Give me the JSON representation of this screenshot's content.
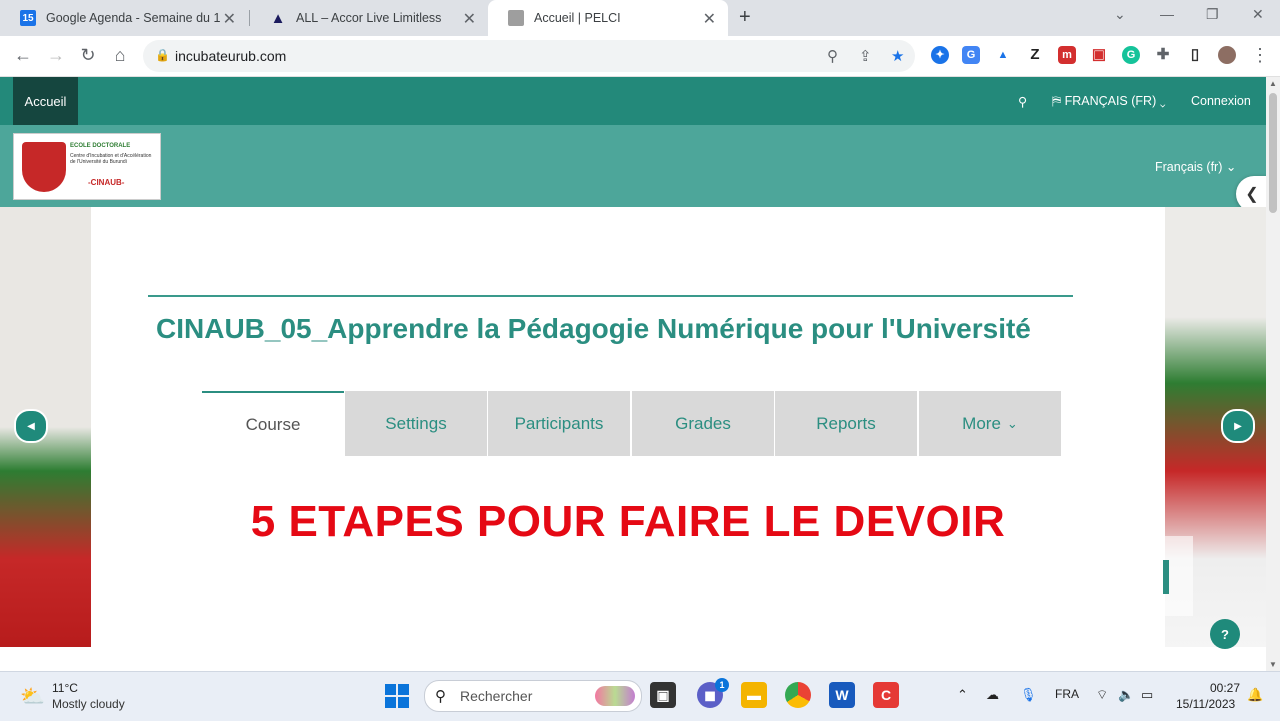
{
  "browser": {
    "tabs": [
      {
        "title": "Google Agenda - Semaine du 1",
        "favicon": "calendar-icon",
        "favicon_text": "15"
      },
      {
        "title": "ALL – Accor Live Limitless",
        "favicon": "accor-icon"
      },
      {
        "title": "Accueil | PELCI",
        "favicon": "page-icon",
        "active": true
      }
    ],
    "url": "incubateurub.com"
  },
  "site": {
    "nav_home": "Accueil",
    "language_menu": "FRANÇAIS (FR)",
    "login": "Connexion",
    "language_secondary": "Français (fr)",
    "logo": {
      "line1": "ECOLE DOCTORALE",
      "line2": "Centre d'Incubation et d'Accélération de l'Université du Burundi",
      "line3": "-CINAUB-"
    }
  },
  "course": {
    "title": "CINAUB_05_Apprendre la Pédagogie Numérique pour l'Université",
    "tabs": [
      "Course",
      "Settings",
      "Participants",
      "Grades",
      "Reports",
      "More"
    ],
    "banner": "5 ETAPES POUR FAIRE LE DEVOIR"
  },
  "taskbar": {
    "temperature": "11°C",
    "weather": "Mostly cloudy",
    "search_placeholder": "Rechercher",
    "chat_badge": "1",
    "language": "FRA",
    "time": "00:27",
    "date": "15/11/2023"
  },
  "colors": {
    "navbar": "#23897a",
    "subheader": "#4da69a",
    "title": "#2b8e81",
    "banner": "#e50914"
  }
}
